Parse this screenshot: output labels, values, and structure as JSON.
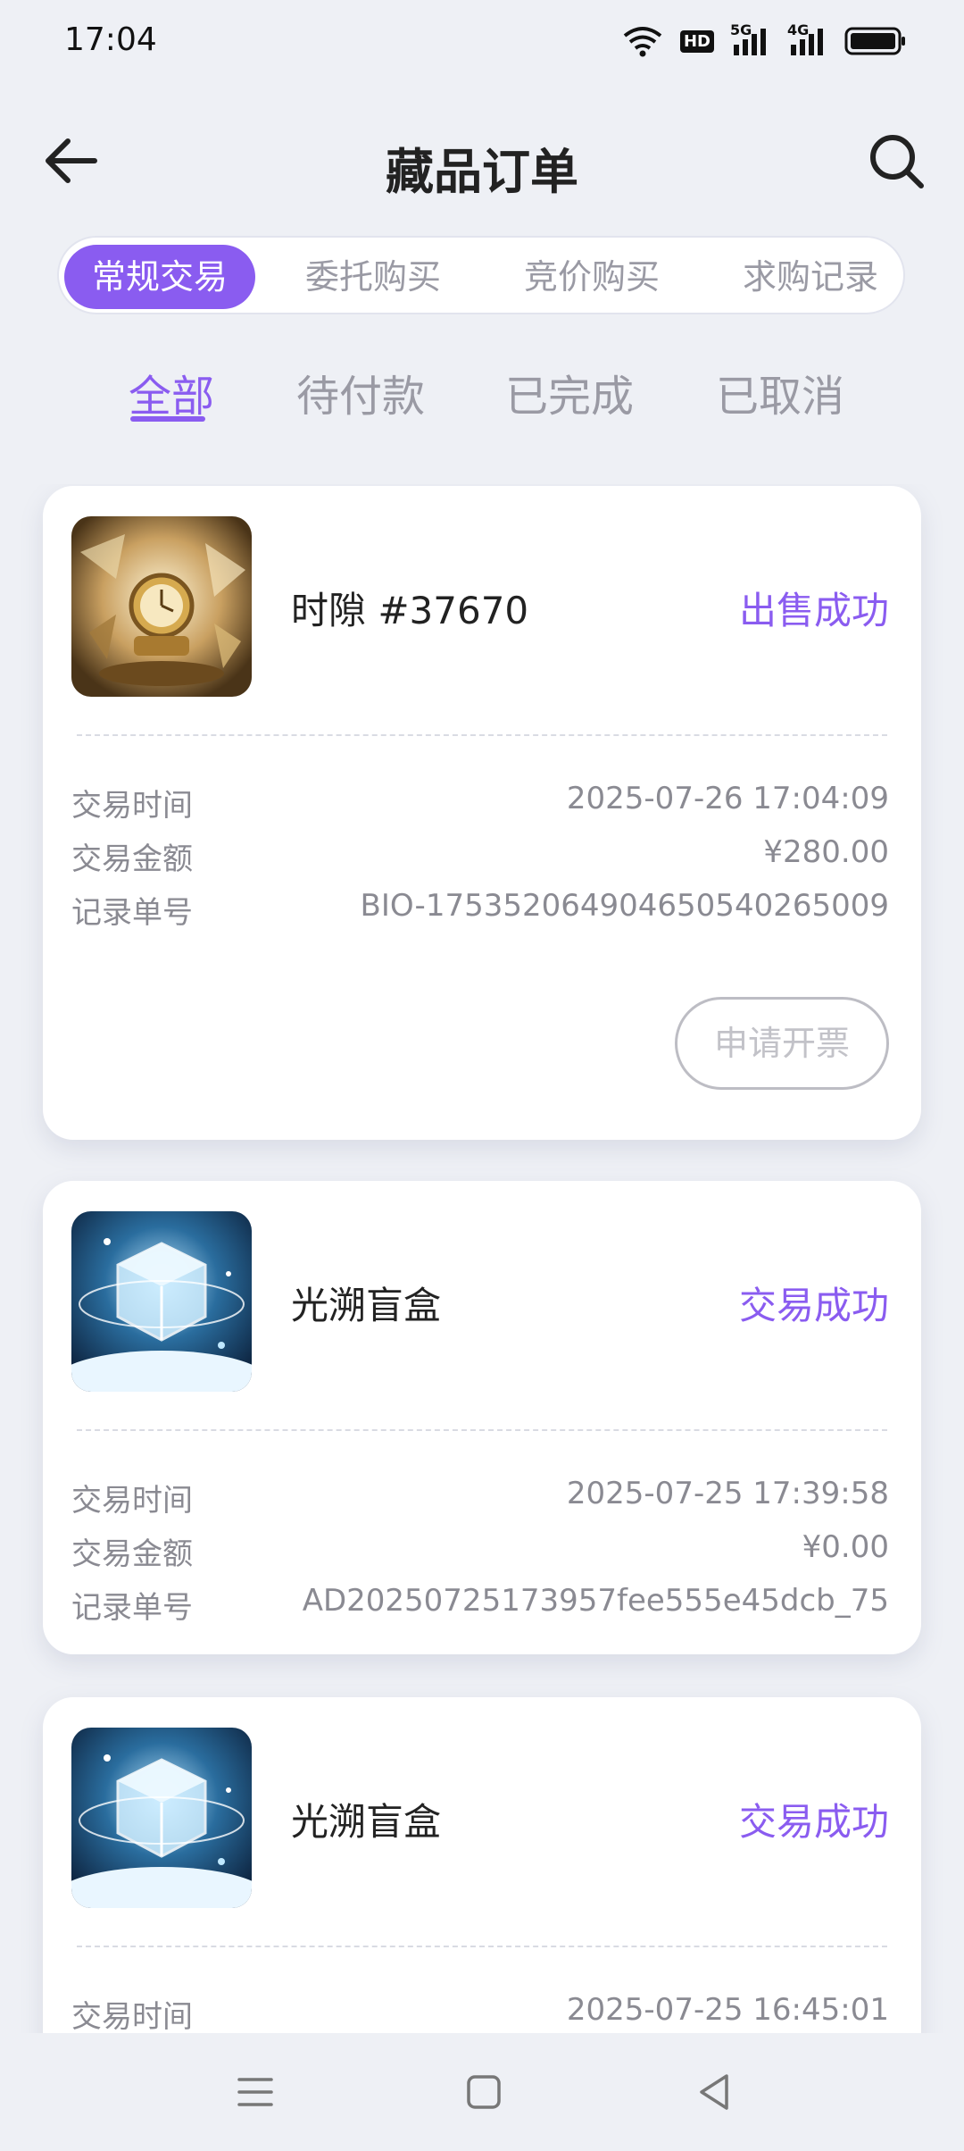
{
  "status_bar": {
    "time": "17:04",
    "icons": [
      "wifi-icon",
      "hd-icon",
      "signal-5g-icon",
      "signal-4g-icon",
      "battery-icon"
    ],
    "hd_text": "HD",
    "net1": "5G",
    "net2": "4G"
  },
  "header": {
    "title": "藏品订单",
    "back_icon": "arrow-left-icon",
    "search_icon": "search-icon"
  },
  "segment_tabs": [
    {
      "label": "常规交易",
      "active": true
    },
    {
      "label": "委托购买",
      "active": false
    },
    {
      "label": "竞价购买",
      "active": false
    },
    {
      "label": "求购记录",
      "active": false
    }
  ],
  "filter_tabs": [
    {
      "label": "全部",
      "active": true
    },
    {
      "label": "待付款",
      "active": false
    },
    {
      "label": "已完成",
      "active": false
    },
    {
      "label": "已取消",
      "active": false
    }
  ],
  "orders": [
    {
      "name": "时隙  #37670",
      "status": "出售成功",
      "rows": [
        {
          "label": "交易时间",
          "value": "2025-07-26 17:04:09"
        },
        {
          "label": "交易金额",
          "value": "¥280.00"
        },
        {
          "label": "记录单号",
          "value": "BIO-17535206490465054026500​9"
        }
      ],
      "action": "申请开票"
    },
    {
      "name": "光溯盲盒",
      "status": "交易成功",
      "rows": [
        {
          "label": "交易时间",
          "value": "2025-07-25 17:39:58"
        },
        {
          "label": "交易金额",
          "value": "¥0.00"
        },
        {
          "label": "记录单号",
          "value": "AD20250725173957fee555e45dcb_75"
        }
      ]
    },
    {
      "name": "光溯盲盒",
      "status": "交易成功",
      "rows": [
        {
          "label": "交易时间",
          "value": "2025-07-25 16:45:01"
        }
      ]
    }
  ],
  "nav_bar": {
    "icons": [
      "menu-icon",
      "home-square-icon",
      "back-triangle-icon"
    ]
  },
  "colors": {
    "accent": "#8a5cf0",
    "background": "#eef0f5"
  }
}
